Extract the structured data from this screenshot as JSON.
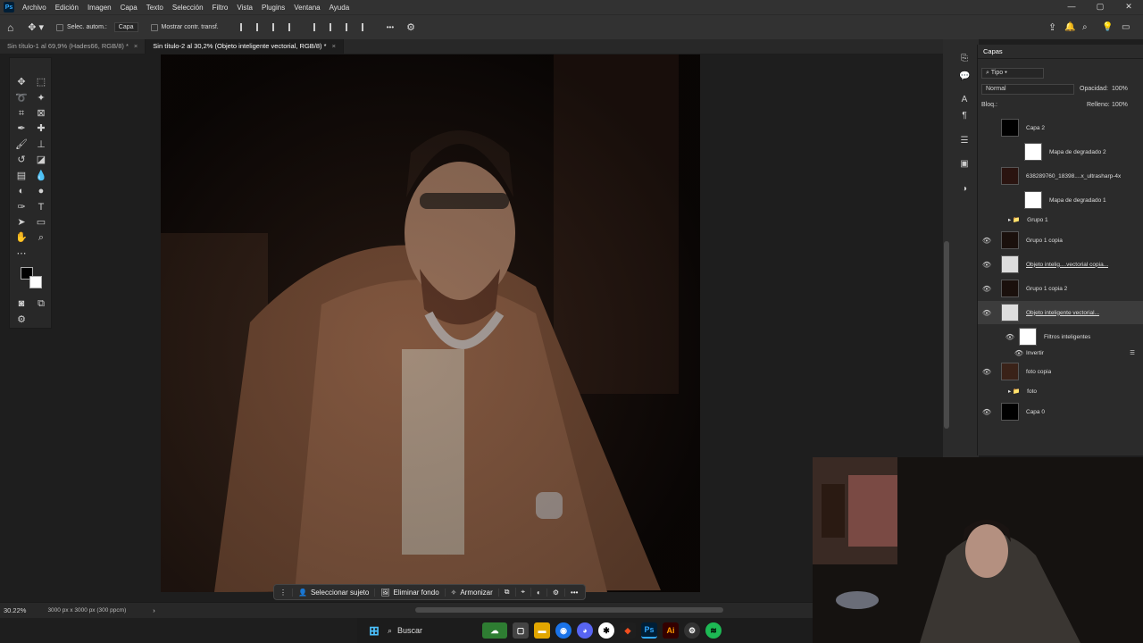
{
  "menubar": {
    "logo": "Ps",
    "items": [
      "Archivo",
      "Edición",
      "Imagen",
      "Capa",
      "Texto",
      "Selección",
      "Filtro",
      "Vista",
      "Plugins",
      "Ventana",
      "Ayuda"
    ],
    "window_controls": [
      "—",
      "▢",
      "✕"
    ]
  },
  "optbar": {
    "auto_select": "Selec. autom.:",
    "target": "Capa",
    "show_transform": "Mostrar contr. transf.",
    "more": "•••"
  },
  "tabs": [
    {
      "label": "Sin título-1 al 69,9% (Hades66, RGB/8) *",
      "close": "×"
    },
    {
      "label": "Sin título-2 al 30,2% (Objeto inteligente vectorial, RGB/8) *",
      "close": "×"
    }
  ],
  "status": {
    "zoom": "30.22%",
    "doc_info": "3000 px x 3000 px (300 ppcm)"
  },
  "context_bar": {
    "select_subject": "Seleccionar sujeto",
    "remove_bg": "Eliminar fondo",
    "harmonize": "Armonizar",
    "more": "•••"
  },
  "layers_panel": {
    "title": "Capas",
    "filter": "Tipo",
    "blend_mode": "Normal",
    "opacity_label": "Opacidad:",
    "opacity": "100%",
    "lock_label": "Bloq.:",
    "fill_label": "Relleno:",
    "fill": "100%",
    "layers": [
      {
        "name": "Capa 2",
        "visible": false
      },
      {
        "name": "Mapa de degradado 2",
        "visible": false
      },
      {
        "name": "638289760_18398....x_ultrasharp-4x",
        "visible": false
      },
      {
        "name": "Mapa de degradado 1",
        "visible": false
      },
      {
        "name": "Grupo 1",
        "visible": false
      },
      {
        "name": "Grupo 1 copia",
        "visible": true
      },
      {
        "name": "Objeto intelig....vectorial copia...",
        "visible": true
      },
      {
        "name": "Grupo 1 copia 2",
        "visible": true
      },
      {
        "name": "Objeto inteligente vectorial...",
        "visible": true
      },
      {
        "name": "Filtros inteligentes",
        "visible": true
      },
      {
        "name": "Invertir",
        "visible": true
      },
      {
        "name": "foto copia",
        "visible": true
      },
      {
        "name": "foto",
        "visible": false
      },
      {
        "name": "Capa 0",
        "visible": true
      }
    ]
  },
  "taskbar": {
    "search": "Buscar",
    "apps": [
      "Ps",
      "Ai"
    ]
  },
  "colors": {
    "ps_blue": "#31a8ff",
    "ai_orange": "#ff9a00",
    "panel": "#2b2b2b"
  }
}
